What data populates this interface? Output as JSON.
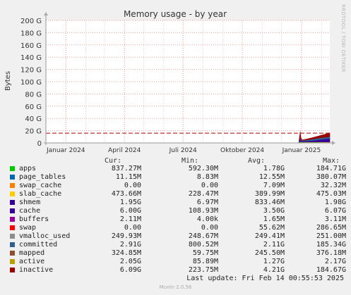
{
  "chart_data": {
    "type": "area",
    "title": "Memory usage - by year",
    "ylabel": "Bytes",
    "ylim": [
      0,
      200
    ],
    "yunit": "G",
    "yticks": [
      "0",
      "20 G",
      "40 G",
      "60 G",
      "80 G",
      "100 G",
      "120 G",
      "140 G",
      "160 G",
      "180 G",
      "200 G"
    ],
    "ytick_values": [
      0,
      20,
      40,
      60,
      80,
      100,
      120,
      140,
      160,
      180,
      200
    ],
    "xlim": [
      "2023-12-01",
      "2025-02-14"
    ],
    "xticks": [
      {
        "label": "Januar 2024",
        "date": "2024-01-01"
      },
      {
        "label": "April 2024",
        "date": "2024-04-01"
      },
      {
        "label": "Juli 2024",
        "date": "2024-07-01"
      },
      {
        "label": "Oktober 2024",
        "date": "2024-10-01"
      },
      {
        "label": "Januar 2025",
        "date": "2025-01-01"
      }
    ],
    "reference_line": {
      "value": 16,
      "color": "#aa0000",
      "style": "dashed"
    },
    "series_points": [
      {
        "date": "2024-12-28",
        "apps": 0.6,
        "slab_cache": 0.3,
        "cache": 0.2,
        "committed": 0.8,
        "inactive": 0.3
      },
      {
        "date": "2024-12-30",
        "apps": 1.8,
        "slab_cache": 0.5,
        "cache": 6.1,
        "committed": 2.1,
        "inactive": 8.0
      },
      {
        "date": "2024-12-31",
        "apps": 1.2,
        "slab_cache": 0.4,
        "cache": 2.0,
        "committed": 2.0,
        "inactive": 3.0
      },
      {
        "date": "2025-01-02",
        "apps": 1.0,
        "slab_cache": 0.4,
        "cache": 1.0,
        "committed": 1.5,
        "inactive": 1.0
      },
      {
        "date": "2025-01-10",
        "apps": 1.1,
        "slab_cache": 0.4,
        "cache": 1.5,
        "committed": 2.0,
        "inactive": 1.5
      },
      {
        "date": "2025-01-20",
        "apps": 1.2,
        "slab_cache": 0.4,
        "cache": 2.5,
        "committed": 2.5,
        "inactive": 2.5
      },
      {
        "date": "2025-02-01",
        "apps": 1.2,
        "slab_cache": 0.5,
        "cache": 4.0,
        "committed": 2.9,
        "inactive": 4.0
      },
      {
        "date": "2025-02-14",
        "apps": 0.8,
        "slab_cache": 0.5,
        "cache": 6.0,
        "committed": 2.9,
        "inactive": 6.1
      }
    ],
    "grid": true
  },
  "legend": {
    "headers": {
      "cur": "Cur:",
      "min": "Min:",
      "avg": "Avg:",
      "max": "Max:"
    },
    "rows": [
      {
        "name": "apps",
        "color": "#00cc00",
        "cur": "837.27M",
        "min": "592.30M",
        "avg": "1.78G",
        "max": "184.71G"
      },
      {
        "name": "page_tables",
        "color": "#0066b3",
        "cur": "11.15M",
        "min": "8.83M",
        "avg": "12.55M",
        "max": "380.07M"
      },
      {
        "name": "swap_cache",
        "color": "#ff8000",
        "cur": "0.00",
        "min": "0.00",
        "avg": "7.09M",
        "max": "32.32M"
      },
      {
        "name": "slab_cache",
        "color": "#ffcc00",
        "cur": "473.66M",
        "min": "228.47M",
        "avg": "389.99M",
        "max": "475.03M"
      },
      {
        "name": "shmem",
        "color": "#330099",
        "cur": "1.95G",
        "min": "6.97M",
        "avg": "833.46M",
        "max": "1.98G"
      },
      {
        "name": "cache",
        "color": "#330099",
        "cur": "6.00G",
        "min": "108.93M",
        "avg": "3.50G",
        "max": "6.07G"
      },
      {
        "name": "buffers",
        "color": "#990099",
        "cur": "2.11M",
        "min": "4.00k",
        "avg": "1.65M",
        "max": "3.11M"
      },
      {
        "name": "swap",
        "color": "#ff0000",
        "cur": "0.00",
        "min": "0.00",
        "avg": "55.62M",
        "max": "286.65M"
      },
      {
        "name": "vmalloc_used",
        "color": "#8c8c8c",
        "cur": "249.93M",
        "min": "248.67M",
        "avg": "249.41M",
        "max": "251.00M"
      },
      {
        "name": "committed",
        "color": "#2f5f8f",
        "cur": "2.91G",
        "min": "800.52M",
        "avg": "2.11G",
        "max": "185.34G"
      },
      {
        "name": "mapped",
        "color": "#8f4f2f",
        "cur": "324.85M",
        "min": "59.75M",
        "avg": "245.50M",
        "max": "376.18M"
      },
      {
        "name": "active",
        "color": "#b8a000",
        "cur": "2.05G",
        "min": "85.89M",
        "avg": "1.27G",
        "max": "2.17G"
      },
      {
        "name": "inactive",
        "color": "#990000",
        "cur": "6.09G",
        "min": "223.75M",
        "avg": "4.21G",
        "max": "184.67G"
      }
    ]
  },
  "last_update": "Last update: Fri Feb 14 00:55:53 2025",
  "footer": "Munin 2.0.56",
  "side_label": "RRDTOOL / TOBI OETIKER"
}
